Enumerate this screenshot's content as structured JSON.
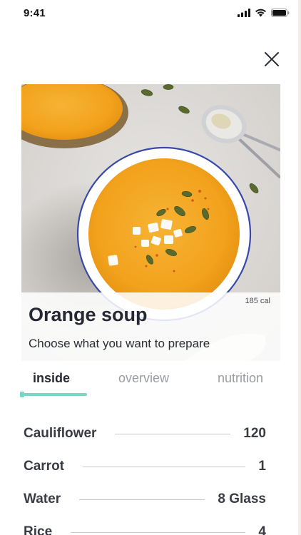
{
  "status_bar": {
    "time": "9:41",
    "icons": [
      "cellular-signal-icon",
      "wifi-icon",
      "battery-icon"
    ]
  },
  "header": {
    "close_icon": "close-icon"
  },
  "recipe": {
    "title": "Orange soup",
    "subtitle": "Choose what you want to prepare",
    "calories": "185 cal",
    "image": "orange-soup-photo"
  },
  "tabs": [
    {
      "label": "inside",
      "active": true
    },
    {
      "label": "overview",
      "active": false
    },
    {
      "label": "nutrition",
      "active": false
    }
  ],
  "ingredients": [
    {
      "name": "Cauliflower",
      "quantity": "120"
    },
    {
      "name": "Carrot",
      "quantity": "1"
    },
    {
      "name": "Water",
      "quantity": "8 Glass"
    },
    {
      "name": "Rice",
      "quantity": "4"
    }
  ],
  "colors": {
    "accent": "#79d7c8",
    "text_primary": "#262833",
    "text_muted": "#9a9ca3",
    "soup": "#f5a623"
  }
}
